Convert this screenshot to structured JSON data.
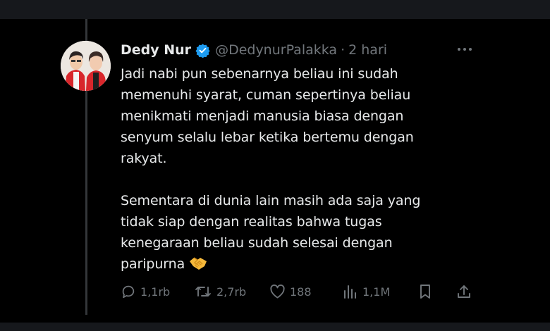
{
  "tweet": {
    "author_name": "Dedy Nur",
    "handle": "@DedynurPalakka",
    "separator": "·",
    "time": "2 hari",
    "paragraph1": "Jadi nabi pun sebenarnya beliau ini sudah\nmemenuhi syarat, cuman sepertinya beliau\nmenikmati menjadi manusia biasa dengan\nsenyum selalu lebar ketika bertemu dengan\nrakyat.",
    "paragraph2": "Sementara di dunia lain masih ada saja yang\ntidak siap dengan realitas bahwa tugas\nkenegaraan beliau sudah selesai dengan\nparipurna",
    "emoji": "handshake"
  },
  "actions": {
    "replies": "1,1rb",
    "retweets": "2,7rb",
    "likes": "188",
    "views": "1,1M"
  },
  "colors": {
    "background": "#000000",
    "text": "#e7e9ea",
    "muted": "#71767b",
    "verified": "#1d9bf0"
  }
}
